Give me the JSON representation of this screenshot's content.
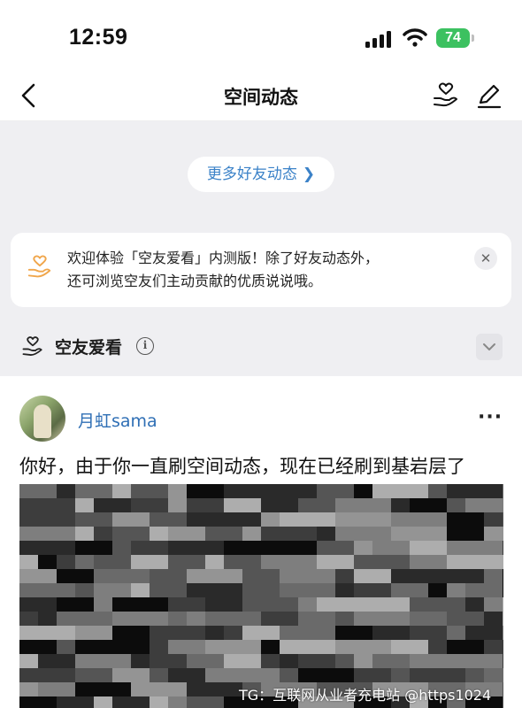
{
  "status_bar": {
    "time": "12:59",
    "battery": "74",
    "icons": [
      "cellular-signal-icon",
      "wifi-icon",
      "battery-icon"
    ]
  },
  "nav": {
    "title": "空间动态",
    "icons": [
      "back-icon",
      "heart-hand-icon",
      "edit-icon"
    ]
  },
  "more_friends_label": "更多好友动态",
  "notice": {
    "line1": "欢迎体验「空友爱看」内测版！除了好友动态外，",
    "line2": "还可浏览空友们主动贡献的优质说说哦。",
    "close": "✕"
  },
  "section": {
    "title": "空友爱看",
    "info": "i"
  },
  "post": {
    "author": "月虹sama",
    "more": "···",
    "text": "你好，由于你一直刷空间动态，现在已经刷到基岩层了"
  },
  "watermark": "TG：互联网从业者充电站 @https1024",
  "colors": {
    "accent_blue": "#3b82c8",
    "background_gray": "#efeff2",
    "battery_green": "#3cc160"
  }
}
